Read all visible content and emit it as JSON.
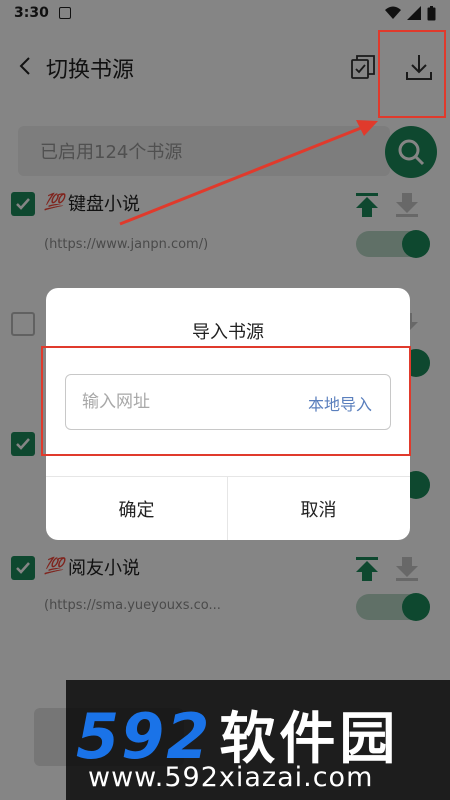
{
  "status_bar": {
    "time": "3:30"
  },
  "app_bar": {
    "title": "切换书源"
  },
  "search": {
    "placeholder": "已启用124个书源"
  },
  "sources": [
    {
      "emoji": "💯",
      "name": "键盘小说",
      "url": "(https://www.janpn.com/)",
      "checked": true,
      "enabled": true
    },
    {
      "emoji": "",
      "name": "",
      "url": "",
      "checked": false,
      "enabled": true
    },
    {
      "emoji": "",
      "name": "",
      "url": "",
      "checked": true,
      "enabled": true
    },
    {
      "emoji": "💯",
      "name": "阅友小说",
      "url": "(https://sma.yueyouxs.co...",
      "checked": true,
      "enabled": true
    }
  ],
  "dialog": {
    "title": "导入书源",
    "input_placeholder": "输入网址",
    "local_import": "本地导入",
    "confirm": "确定",
    "cancel": "取消"
  },
  "watermark": {
    "logo_num": "592",
    "logo_cn": "软件园",
    "url": "www.592xiazai.com"
  },
  "colors": {
    "accent": "#1b8a5a",
    "highlight": "#e03a2c",
    "link": "#5a7fbd"
  }
}
